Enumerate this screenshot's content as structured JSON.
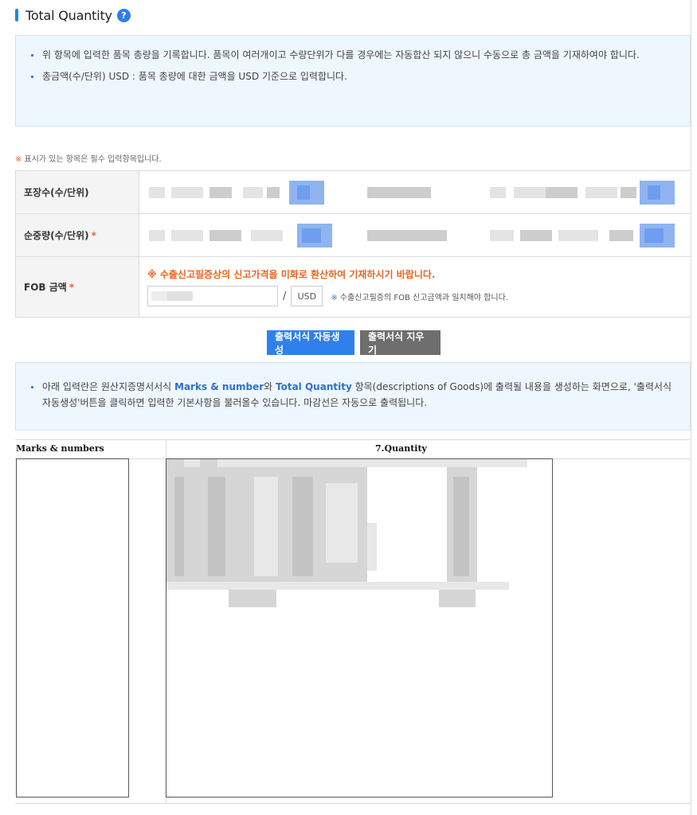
{
  "section": {
    "title": "Total Quantity",
    "help_icon": "help-icon"
  },
  "info_top": [
    "위 항목에 입력한 품목 총량을 기록합니다. 품목이 여러개이고 수량단위가 다를 경우에는 자동합산 되지 않으니 수동으로 총 금액을 기재하여야 합니다.",
    "총금액(수/단위) USD : 품목 총량에 대한 금액을 USD 기준으로 입력합니다."
  ],
  "required_note": {
    "star": "※",
    "text": "표시가 있는 항목은 필수 입력항목입니다."
  },
  "form": {
    "row1_label": "포장수(수/단위)",
    "row2_label": "순중량(수/단위)",
    "row3_label": "FOB 금액",
    "required_mark": "*",
    "fob_warning": "※ 수출신고필증상의 신고가격을 미화로 환산하여 기재하시기 바랍니다.",
    "slash": "/",
    "currency": "USD",
    "fob_hint_star": "※",
    "fob_hint": "수출신고필증의 FOB 신고금액과 일치해야 합니다."
  },
  "buttons": {
    "generate": "출력서식 자동생성",
    "clear": "출력서식 지우기"
  },
  "info_bottom": {
    "part1": "아래 입력란은 원산지증명서서식 ",
    "hl1": "Marks & number",
    "part2": "와 ",
    "hl2": "Total Quantity",
    "part3": " 항목(descriptions of Goods)에 출력될 내용을 생성하는 화면으로, '출력서식자동생성'버튼을 클릭하면 입력한 기본사항을 불러올수 있습니다. 마감선은 자동으로 출력됩니다."
  },
  "output": {
    "col1": "Marks & numbers",
    "col2": "7.Quantity"
  },
  "colors": {
    "accent": "#2f80ed",
    "required": "#e8661f",
    "info_bg": "#eef7fd",
    "secondary_btn": "#6e6e6e"
  }
}
